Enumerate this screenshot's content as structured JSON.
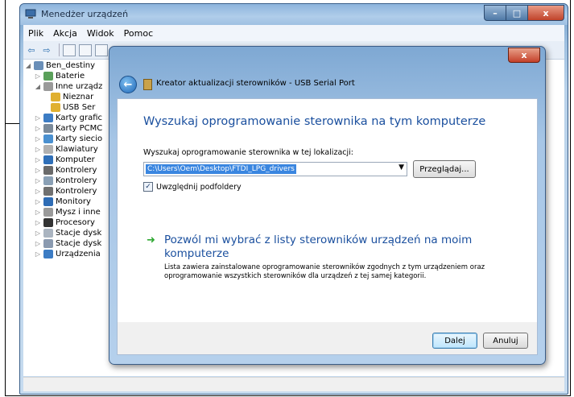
{
  "device_manager": {
    "title": "Menedżer urządzeń",
    "caption_buttons": {
      "minimize": "–",
      "maximize": "□",
      "close": "x"
    },
    "menu": [
      "Plik",
      "Akcja",
      "Widok",
      "Pomoc"
    ],
    "tree": [
      {
        "label": "Ben_destiny"
      },
      {
        "label": "Baterie"
      },
      {
        "label": "Inne urządz"
      },
      {
        "label": "Nieznar"
      },
      {
        "label": "USB Ser"
      },
      {
        "label": "Karty grafic"
      },
      {
        "label": "Karty PCMC"
      },
      {
        "label": "Karty siecio"
      },
      {
        "label": "Klawiatury"
      },
      {
        "label": "Komputer"
      },
      {
        "label": "Kontrolery"
      },
      {
        "label": "Kontrolery"
      },
      {
        "label": "Kontrolery"
      },
      {
        "label": "Monitory"
      },
      {
        "label": "Mysz i inne"
      },
      {
        "label": "Procesory"
      },
      {
        "label": "Stacje dysk"
      },
      {
        "label": "Stacje dysk"
      },
      {
        "label": "Urządzenia"
      }
    ]
  },
  "wizard": {
    "close": "x",
    "back_glyph": "←",
    "header_title": "Kreator aktualizacji sterowników - USB Serial Port",
    "heading": "Wyszukaj oprogramowanie sterownika na tym komputerze",
    "location_label": "Wyszukaj oprogramowanie sterownika w tej lokalizacji:",
    "location_value": "C:\\Users\\Oem\\Desktop\\FTDI_LPG_drivers",
    "combo_arrow": "▼",
    "browse_label": "Przeglądaj...",
    "checkbox_label": "Uwzględnij podfoldery",
    "checkbox_mark": "✓",
    "option_arrow": "➜",
    "option_title": "Pozwól mi wybrać z listy sterowników urządzeń na moim komputerze",
    "option_desc": "Lista zawiera zainstalowane oprogramowanie sterowników zgodnych z tym urządzeniem oraz oprogramowanie wszystkich sterowników dla urządzeń z tej samej kategorii.",
    "next_label": "Dalej",
    "cancel_label": "Anuluj"
  },
  "colors": {
    "accent_blue": "#1a4f9e",
    "selection": "#3a86e0",
    "option_arrow": "#2fa832"
  }
}
